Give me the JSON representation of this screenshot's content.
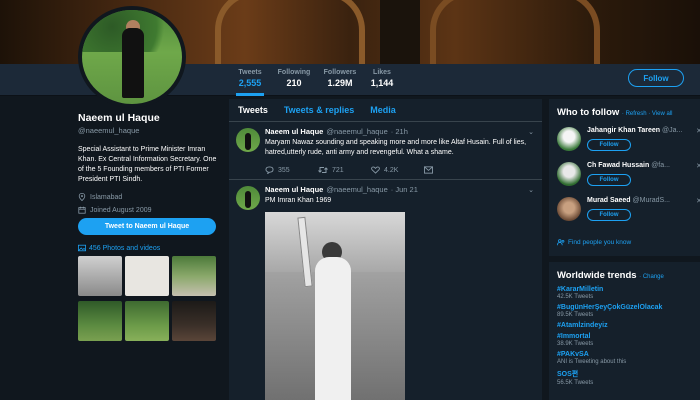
{
  "profile": {
    "name": "Naeem ul Haque",
    "handle": "@naeemul_haque",
    "bio": "Special Assistant to Prime Minister Imran Khan. Ex Central Information Secretary. One of the 5 Founding members of PTI Former President PTI Sindh.",
    "location": "Islamabad",
    "joined": "Joined August 2009",
    "tweet_to_label": "Tweet to Naeem ul Haque",
    "photos_label": "456 Photos and videos"
  },
  "stats": [
    {
      "label": "Tweets",
      "value": "2,555"
    },
    {
      "label": "Following",
      "value": "210"
    },
    {
      "label": "Followers",
      "value": "1.29M"
    },
    {
      "label": "Likes",
      "value": "1,144"
    }
  ],
  "follow_label": "Follow",
  "timeline": {
    "tabs": [
      "Tweets",
      "Tweets & replies",
      "Media"
    ],
    "tweets": [
      {
        "name": "Naeem ul Haque",
        "handle": "@naeemul_haque",
        "time": "· 21h",
        "text": "Maryam Nawaz sounding and speaking more and more like Altaf Husain. Full of lies, hatred,utterly rude, anti army and revengeful. What a shame.",
        "replies": "355",
        "retweets": "721",
        "likes": "4.2K"
      },
      {
        "name": "Naeem ul Haque",
        "handle": "@naeemul_haque",
        "time": "· Jun 21",
        "text": "PM Imran Khan 1969"
      }
    ]
  },
  "who_to_follow": {
    "title": "Who to follow",
    "links": "· Refresh · View all",
    "items": [
      {
        "name": "Jahangir Khan Tareen",
        "handle": "@Ja...",
        "button": "Follow"
      },
      {
        "name": "Ch Fawad Hussain",
        "handle": "@fa...",
        "button": "Follow"
      },
      {
        "name": "Murad Saeed",
        "handle": "@MuradS...",
        "button": "Follow"
      }
    ],
    "find_people": "Find people you know"
  },
  "trends": {
    "title": "Worldwide trends",
    "change": "· Change",
    "items": [
      {
        "tag": "#KararMilletin",
        "meta": "42.5K Tweets"
      },
      {
        "tag": "#BugünHerŞeyÇokGüzelOlacak",
        "meta": "89.5K Tweets"
      },
      {
        "tag": "#Atamİzindeyiz",
        "meta": ""
      },
      {
        "tag": "#Immortal",
        "meta": "38.9K Tweets"
      },
      {
        "tag": "#PAKvSA",
        "meta": "ANI is Tweeting about this"
      },
      {
        "tag": "SOS편",
        "meta": "56.5K Tweets"
      }
    ]
  },
  "colors": {
    "accent": "#1da1f2",
    "background": "#10171e",
    "panel": "#15202b"
  }
}
